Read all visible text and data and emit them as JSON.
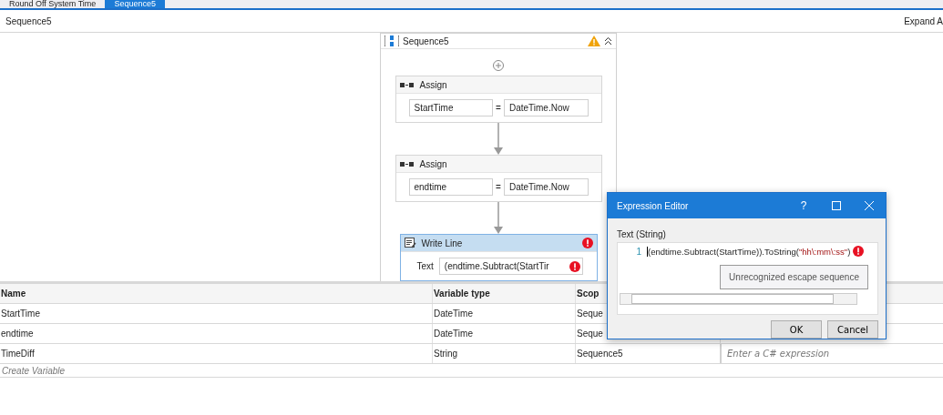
{
  "tabs": [
    {
      "label": "Round Off System Time",
      "selected": false
    },
    {
      "label": "Sequence5",
      "selected": true
    }
  ],
  "breadcrumb": "Sequence5",
  "expand_link": "Expand A",
  "sequence": {
    "title": "Sequence5",
    "warning": true,
    "activities": [
      {
        "kind": "assign",
        "title": "Assign",
        "to": "StartTime",
        "operator": "=",
        "value": "DateTime.Now"
      },
      {
        "kind": "assign",
        "title": "Assign",
        "to": "endtime",
        "operator": "=",
        "value": "DateTime.Now"
      },
      {
        "kind": "write_line",
        "title": "Write Line",
        "error": true,
        "selected": true,
        "label": "Text",
        "value": "(endtime.Subtract(StartTir",
        "value_error": true
      }
    ]
  },
  "variables": {
    "columns": [
      "Name",
      "Variable type",
      "Scop"
    ],
    "rows": [
      {
        "name": "StartTime",
        "type": "DateTime",
        "scope": "Seque"
      },
      {
        "name": "endtime",
        "type": "DateTime",
        "scope": "Seque"
      },
      {
        "name": "TimeDiff",
        "type": "String",
        "scope": "Sequence5",
        "default_placeholder": "Enter a C# expression"
      }
    ],
    "create": "Create Variable"
  },
  "dialog": {
    "title": "Expression Editor",
    "help": "?",
    "label": "Text (String)",
    "line_number": "1",
    "error": true,
    "code": [
      {
        "kind": "plain",
        "text": "(endtime.Subtract(StartTime)).ToString("
      },
      {
        "kind": "string",
        "text": "\"hh\\:mm\\:ss\""
      },
      {
        "kind": "plain",
        "text": ")"
      }
    ],
    "error_tip": "Unrecognized escape sequence",
    "buttons": [
      "OK",
      "Cancel"
    ]
  }
}
